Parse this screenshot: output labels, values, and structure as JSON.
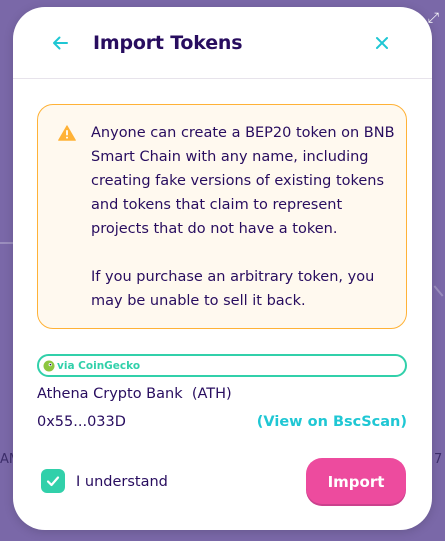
{
  "header": {
    "title": "Import Tokens",
    "back_icon": "arrow-left-icon",
    "close_icon": "close-icon"
  },
  "warning": {
    "icon": "warning-icon",
    "paragraph1": "Anyone can create a BEP20 token on BNB Smart Chain with any name, including creating fake versions of existing tokens and tokens that claim to represent projects that do not have a token.",
    "paragraph2": "If you purchase an arbitrary token, you may be unable to sell it back."
  },
  "source": {
    "label": "via CoinGecko",
    "icon": "coingecko-icon"
  },
  "token": {
    "name": "Athena Crypto Bank  (ATH)",
    "address": "0x55...033D",
    "view_link": "(View on BscScan)"
  },
  "footer": {
    "understand_label": "I understand",
    "understand_checked": true,
    "import_label": "Import"
  },
  "backdrop": {
    "left_text": "AM",
    "right_text": "7"
  },
  "colors": {
    "primary_text": "#280d5f",
    "accent": "#1fc7d4",
    "success": "#31d0aa",
    "warning": "#ffb237",
    "button": "#ed4b9e"
  }
}
